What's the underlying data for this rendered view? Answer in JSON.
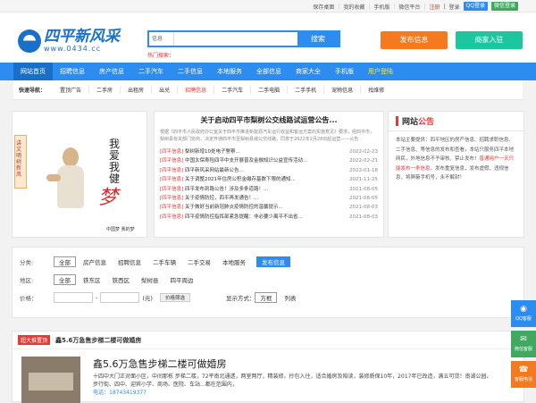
{
  "topbar": {
    "links": [
      "保存桌面",
      "我的收藏",
      "手机版",
      "微信平台"
    ],
    "register": "注册",
    "login": "登录",
    "qq_login": "QQ登录",
    "wx_login": "微信登录"
  },
  "header": {
    "logo_cn": "四平新风采",
    "logo_url": "www.0434.cc",
    "search_select": "信息",
    "search_button": "搜索",
    "hot_search": "热门搜索：",
    "post_button": "发布信息",
    "merchant_button": "商家入驻"
  },
  "nav": [
    "网站首页",
    "招聘信息",
    "房产信息",
    "二手汽车",
    "二手信息",
    "本地服务",
    "全部信息",
    "商家大全",
    "手机版",
    "用户登陆"
  ],
  "quicknav": {
    "title": "快速导航：",
    "items": [
      "置顶广告",
      "二手房",
      "出租房",
      "出兑",
      "招聘信息",
      "二手汽车",
      "二手电脑",
      "二手手机",
      "宠物信息",
      "找维修"
    ]
  },
  "banner": {
    "scroll_text": "讲文明树新风",
    "calligraphy": "我爱我健",
    "calligraphy_red": "梦",
    "footer": "中国梦 我的梦"
  },
  "news": {
    "title": "关于启动四平市梨树公交线路试运营公告...",
    "summary": "根据《四平市人民政府办公室关于四平市推进新能源汽车运行收益和客运方案的实施意见》要求，经四平市，梨树县有关部门协商，决定开通四平市至梨树县城公交线路，同意于2022年2月28日起运营——公告",
    "rows": [
      {
        "tag": "[四平信息]",
        "text": "梨树新增10处电子警察...",
        "date": "2022-02-23"
      },
      {
        "tag": "[四平信息]",
        "text": "中国太保寿险四平中支开展普及金融知识公益宣传活动...",
        "date": "2022-02-21"
      },
      {
        "tag": "[四平信息]",
        "text": "四平新风采网站最新公告...",
        "date": "2022-01-18"
      },
      {
        "tag": "[四平信息]",
        "text": "关于调整2021年住房公积金缴存基数下限的通知...",
        "date": "2021-11-25"
      },
      {
        "tag": "[四平信息]",
        "text": "四平发布到路公告！涉及多条道路！...",
        "date": "2021-08-05"
      },
      {
        "tag": "[四平信息]",
        "text": "关于疫情防控，四平再发通告！...",
        "date": "2021-08-05"
      },
      {
        "tag": "[四平信息]",
        "text": "关于做好当前新冠肺炎疫情防控的温馨提示...",
        "date": "2021-08-03"
      },
      {
        "tag": "[四平信息]",
        "text": "四平疫情防控指挥部紧急提醒：非必要少离平不出省...",
        "date": "2021-08-03"
      }
    ]
  },
  "notice": {
    "title_a": "网站",
    "title_b": "公告",
    "body": "本站主要提供：四平地区的房产信息、招聘求职信息、二手信息、等信息的发布和查看，本站只服务四平本地网民，外地信息不予审核，禁止发布！",
    "red": "普通用户一天只能发布一条信息",
    "body2": "，发布重复信息，发布虚假、违规信息，将屏蔽手机号，永不解封！"
  },
  "filter": {
    "category_label": "分类:",
    "categories": [
      "全部",
      "房产信息",
      "招聘信息",
      "二手车辆",
      "二手交易",
      "本地服务"
    ],
    "post_button": "发布信息",
    "region_label": "地区:",
    "regions": [
      "全部",
      "铁东区",
      "铁西区",
      "梨树县",
      "四平周边"
    ],
    "price_label": "价格：",
    "price_unit": "(元)",
    "price_button": "价格筛选",
    "display_label": "显示方式：",
    "display_options": [
      "方框",
      "列表"
    ]
  },
  "listing": {
    "badge": "超大推置顶",
    "head_title": "鑫5.6万急售步梯二楼可做婚房",
    "title": "鑫5.6万急售步梯二楼可做婚房",
    "desc": "十四中大门正对面小区，中间那栋 步梯二楼，72平南北通透，两室两厅，精装修，拎包入住，适合婚房及陪读，装修质保10年，2017年已改造，满五可贷！南湖公园、步行街、四中、迎宾小学、商场、医院、车站...都在范围内，",
    "phone": "电话：18743419377"
  },
  "floats": {
    "qq": "QQ客服",
    "wx": "微信客服",
    "tel": "客服电话"
  },
  "colors": {
    "primary": "#2d8cf0",
    "orange": "#f47a20",
    "teal": "#1ec6a0",
    "red": "#e53935"
  }
}
